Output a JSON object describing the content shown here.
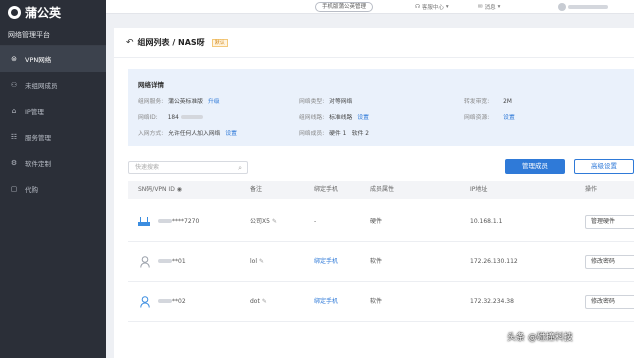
{
  "sidebar": {
    "logo": "蒲公英",
    "platform_title": "网络管理平台",
    "items": [
      {
        "label": "VPN网络",
        "icon": "network-icon",
        "active": true
      },
      {
        "label": "未组网成员",
        "icon": "user-icon",
        "active": false
      },
      {
        "label": "IP管理",
        "icon": "ip-icon",
        "active": false
      },
      {
        "label": "服务管理",
        "icon": "service-icon",
        "active": false
      },
      {
        "label": "软件定制",
        "icon": "software-icon",
        "active": false
      },
      {
        "label": "代购",
        "icon": "cart-icon",
        "active": false
      }
    ]
  },
  "topbar": {
    "mobile_button": "手机版蒲公英管理",
    "help": "客服中心",
    "messages": "消息"
  },
  "header": {
    "title": "组网列表 / NAS呀",
    "tag": "默认"
  },
  "info": {
    "title": "网络详情",
    "service_label": "组网服务:",
    "service_value": "蒲公英标准版",
    "service_link": "升级",
    "type_label": "网络类型:",
    "type_value": "对等网络",
    "bandwidth_label": "转发带宽:",
    "bandwidth_value": "2M",
    "network_id_label": "网络ID:",
    "network_id_value": "184",
    "line_label": "组网线路:",
    "line_value": "标准线路",
    "line_link": "设置",
    "resource_label": "网络资源:",
    "resource_link": "设置",
    "join_label": "入网方式:",
    "join_value": "允许任何人加入网络",
    "join_link": "设置",
    "members_label": "网络成员:",
    "members_value": "硬件 1   软件 2"
  },
  "search": {
    "placeholder": "快速搜索"
  },
  "buttons": {
    "manage_members": "管理成员",
    "advanced": "高级设置"
  },
  "table": {
    "headers": [
      "SN码/VPN ID",
      "备注",
      "绑定手机",
      "成员属性",
      "IP地址",
      "操作"
    ],
    "rows": [
      {
        "id": "****7270",
        "note": "公司X5",
        "phone": "-",
        "type": "硬件",
        "ip": "10.168.1.1",
        "action": "管理硬件",
        "icon": "router-icon"
      },
      {
        "id": "**01",
        "note": "lol",
        "phone": "绑定手机",
        "type": "软件",
        "ip": "172.26.130.112",
        "action": "修改密码",
        "icon": "user-icon"
      },
      {
        "id": "**02",
        "note": "dot",
        "phone": "绑定手机",
        "type": "软件",
        "ip": "172.32.234.38",
        "action": "修改密码",
        "icon": "user-icon"
      }
    ]
  },
  "watermark": "头条 @碰撞科技",
  "colors": {
    "accent": "#2f7ad8",
    "sidebar": "#2b2f38",
    "info_bg": "#eaf1fb"
  }
}
